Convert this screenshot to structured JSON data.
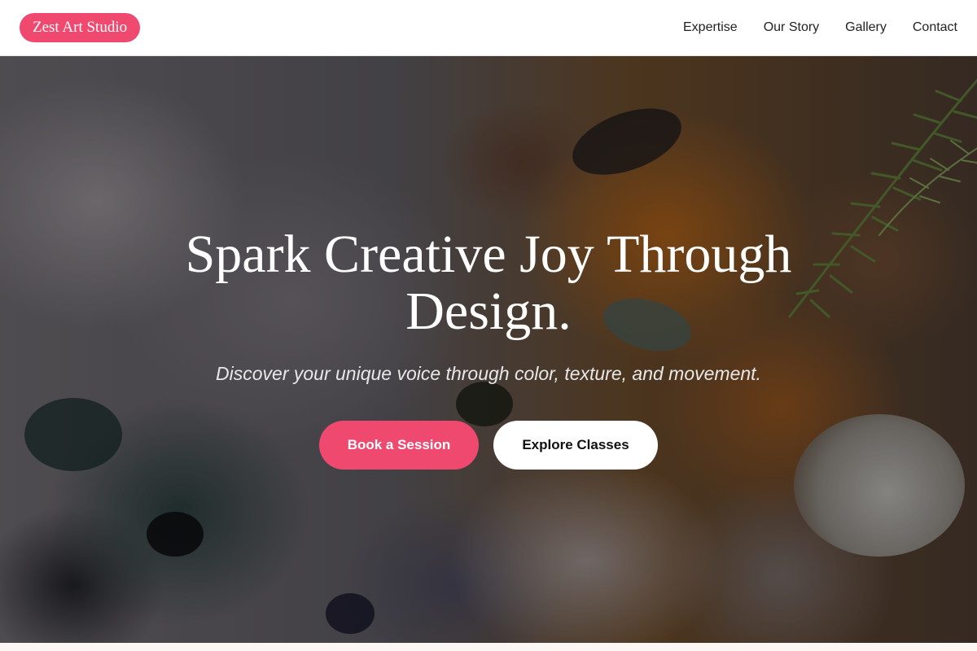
{
  "header": {
    "brand": "Zest Art Studio",
    "nav": [
      {
        "label": "Expertise"
      },
      {
        "label": "Our Story"
      },
      {
        "label": "Gallery"
      },
      {
        "label": "Contact"
      }
    ]
  },
  "hero": {
    "title": "Spark Creative Joy Through Design.",
    "subtitle": "Discover your unique voice through color, texture, and movement.",
    "primary_cta": "Book a Session",
    "secondary_cta": "Explore Classes"
  },
  "colors": {
    "accent": "#f0496f",
    "header_bg": "#ffffff",
    "hero_text": "#ffffff"
  }
}
